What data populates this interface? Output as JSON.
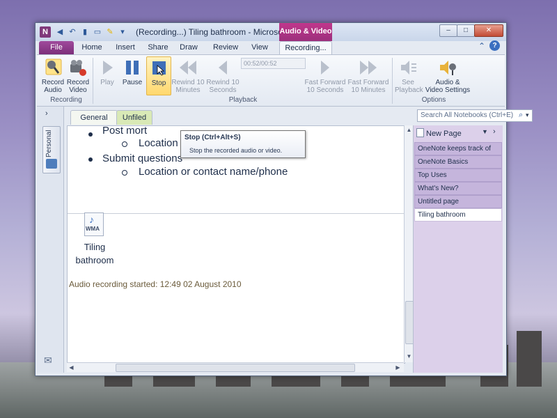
{
  "window": {
    "title": "(Recording...) Tiling bathroom - Microso...",
    "contextual_group": "Audio & Video",
    "controls": {
      "minimize": "–",
      "maximize": "□",
      "close": "✕"
    }
  },
  "ribbon_tabs": [
    "File",
    "Home",
    "Insert",
    "Share",
    "Draw",
    "Review",
    "View",
    "Recording..."
  ],
  "ribbon": {
    "buttons": [
      {
        "label1": "Record",
        "label2": "Audio"
      },
      {
        "label1": "Record",
        "label2": "Video"
      },
      {
        "label1": "Play",
        "label2": ""
      },
      {
        "label1": "Pause",
        "label2": ""
      },
      {
        "label1": "Stop",
        "label2": ""
      },
      {
        "label1": "Rewind 10",
        "label2": "Minutes"
      },
      {
        "label1": "Rewind 10",
        "label2": "Seconds"
      },
      {
        "label1": "Fast Forward",
        "label2": "10 Seconds"
      },
      {
        "label1": "Fast Forward",
        "label2": "10 Minutes"
      },
      {
        "label1": "See",
        "label2": "Playback"
      },
      {
        "label1": "Audio &",
        "label2": "Video Settings"
      }
    ],
    "time_display": "00:52/00:52",
    "groups": [
      "Recording",
      "Playback",
      "Options"
    ]
  },
  "tooltip": {
    "title": "Stop (Ctrl+Alt+S)",
    "description": "Stop the recorded audio or video."
  },
  "notebook": {
    "name": "Personal"
  },
  "section_tabs": [
    "General",
    "Unfiled"
  ],
  "search": {
    "placeholder": "Search All Notebooks (Ctrl+E)"
  },
  "page": {
    "lines": [
      "Post mort",
      "Location or contact name/phone",
      "Submit questions",
      "Location or contact name/phone"
    ],
    "file_icon_label": "WMA",
    "file_caption_1": "Tiling",
    "file_caption_2": "bathroom",
    "audio_note": "Audio recording started: 12:49 02 August 2010"
  },
  "pages_panel": {
    "new_page": "New Page",
    "items": [
      "OneNote keeps track of",
      "OneNote Basics",
      "Top Uses",
      "What's New?",
      "Untitled page",
      "Tiling bathroom"
    ],
    "selected_index": 5
  }
}
